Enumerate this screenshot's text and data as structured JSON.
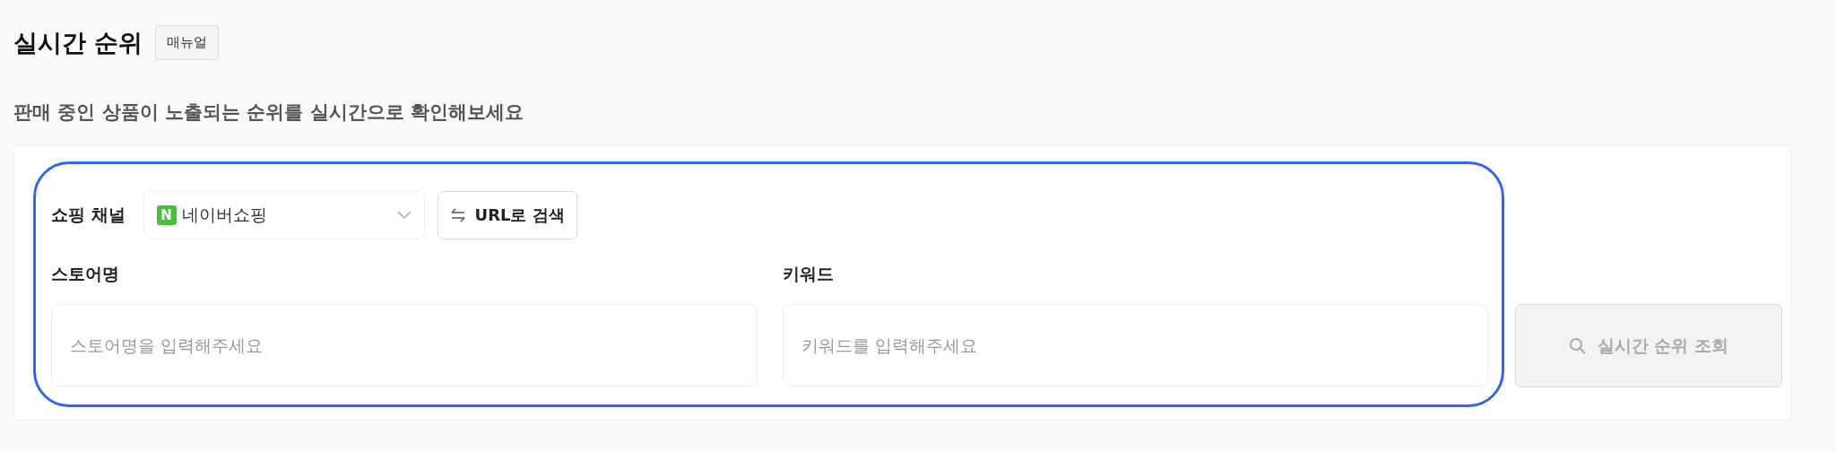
{
  "header": {
    "title": "실시간 순위",
    "manual_button": "매뉴얼",
    "subtitle": "판매 중인 상품이 노출되는 순위를 실시간으로 확인해보세요"
  },
  "form": {
    "channel_label": "쇼핑 채널",
    "channel": {
      "logo": "N",
      "value": "네이버쇼핑"
    },
    "url_button": "URL로 검색",
    "fields": [
      {
        "label": "스토어명",
        "placeholder": "스토어명을 입력해주세요"
      },
      {
        "label": "키워드",
        "placeholder": "키워드를 입력해주세요"
      }
    ],
    "search_button": {
      "label": "실시간 순위 조회",
      "disabled": true
    }
  }
}
